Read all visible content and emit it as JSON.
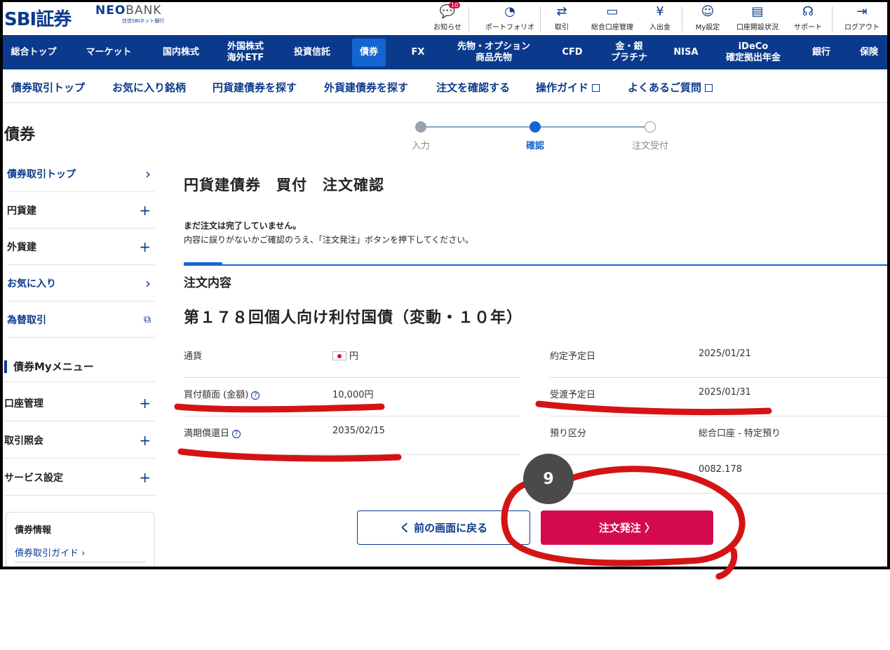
{
  "header": {
    "logo_sbi": "SBI証券",
    "logo_neo": "NEO",
    "logo_bank": "BANK",
    "logo_neo_sub": "住信SBIネット銀行",
    "utilities": [
      {
        "label": "お知らせ",
        "icon": "bell-icon",
        "glyph": "💬",
        "badge": "10"
      },
      {
        "label": "ポートフォリオ",
        "icon": "pie-chart-icon",
        "glyph": "◔"
      },
      {
        "label": "取引",
        "icon": "transfer-icon",
        "glyph": "⇄"
      },
      {
        "label": "総合口座管理",
        "icon": "account-icon",
        "glyph": "▭"
      },
      {
        "label": "入出金",
        "icon": "yen-icon",
        "glyph": "¥"
      },
      {
        "label": "My設定",
        "icon": "user-settings-icon",
        "glyph": "☺"
      },
      {
        "label": "口座開設状況",
        "icon": "status-icon",
        "glyph": "▤"
      },
      {
        "label": "サポート",
        "icon": "headset-icon",
        "glyph": "☊"
      },
      {
        "label": "ログアウト",
        "icon": "logout-icon",
        "glyph": "⇥"
      }
    ]
  },
  "mainnav": [
    {
      "label": "総合トップ"
    },
    {
      "label": "マーケット"
    },
    {
      "label": "国内株式"
    },
    {
      "label": "外国株式\n海外ETF"
    },
    {
      "label": "投資信託"
    },
    {
      "label": "債券"
    },
    {
      "label": "FX"
    },
    {
      "label": "先物・オプション\n商品先物"
    },
    {
      "label": "CFD"
    },
    {
      "label": "金・銀\nプラチナ"
    },
    {
      "label": "NISA"
    },
    {
      "label": "iDeCo\n確定拠出年金"
    },
    {
      "label": "銀行"
    },
    {
      "label": "保険"
    }
  ],
  "subnav": [
    {
      "label": "債券取引トップ"
    },
    {
      "label": "お気に入り銘柄"
    },
    {
      "label": "円貨建債券を探す"
    },
    {
      "label": "外貨建債券を探す"
    },
    {
      "label": "注文を確認する"
    },
    {
      "label": "操作ガイド",
      "external": true
    },
    {
      "label": "よくあるご質問",
      "external": true
    }
  ],
  "sidebar": {
    "title": "債券",
    "items": [
      {
        "label": "債券取引トップ",
        "icon": "chevron-right-icon",
        "glyph": "›",
        "blue": true
      },
      {
        "label": "円貨建",
        "icon": "plus-icon",
        "glyph": "+"
      },
      {
        "label": "外貨建",
        "icon": "plus-icon",
        "glyph": "+"
      },
      {
        "label": "お気に入り",
        "icon": "chevron-right-icon",
        "glyph": "›",
        "blue": true
      },
      {
        "label": "為替取引",
        "icon": "external-link-icon",
        "glyph": "⧉",
        "blue": true
      }
    ],
    "my_menu": "債券Myメニュー",
    "my_items": [
      {
        "label": "口座管理",
        "icon": "plus-icon",
        "glyph": "+"
      },
      {
        "label": "取引照会",
        "icon": "plus-icon",
        "glyph": "+"
      },
      {
        "label": "サービス設定",
        "icon": "plus-icon",
        "glyph": "+"
      }
    ],
    "info_title": "債券情報",
    "info_link": "債券取引ガイド ›"
  },
  "stepper": {
    "steps": [
      {
        "label": "入力",
        "state": "done"
      },
      {
        "label": "確認",
        "state": "current"
      },
      {
        "label": "注文受付",
        "state": "todo"
      }
    ]
  },
  "main": {
    "title": "円貨建債券　買付　注文確認",
    "notice_bold": "まだ注文は完了していません。",
    "notice_text": "内容に誤りがないかご確認のうえ、「注文発注」ボタンを押下してください。",
    "section": "注文内容",
    "bond_name": "第１７８回個人向け利付国債（変動・１０年）",
    "left_rows": [
      {
        "key": "通貨",
        "value": "円",
        "flag": true
      },
      {
        "key": "買付額面 (金額)",
        "value": "10,000円",
        "help": true
      },
      {
        "key": "満期償還日",
        "value": "2035/02/15",
        "help": true
      }
    ],
    "right_rows": [
      {
        "key": "約定予定日",
        "value": "2025/01/21"
      },
      {
        "key": "受渡予定日",
        "value": "2025/01/31"
      },
      {
        "key": "預り区分",
        "value": "総合口座 - 特定預り"
      },
      {
        "key": "",
        "value": "0082.178"
      }
    ],
    "back_button": "く 前の画面に戻る",
    "submit_button": "注文発注 〉"
  },
  "annotation": {
    "step_number": "9",
    "ink_color": "#d41414"
  },
  "colors": {
    "brand_navy": "#0b3a8c",
    "active_tab": "#1565d0",
    "submit_red": "#d40a50"
  }
}
